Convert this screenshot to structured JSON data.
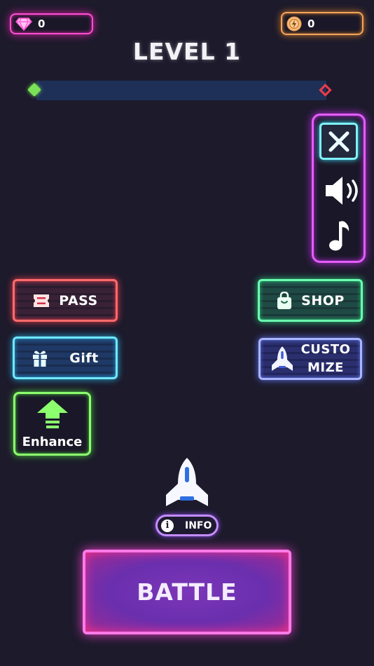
{
  "currency": {
    "gems": "0",
    "energy": "0"
  },
  "level": {
    "title": "LEVEL 1",
    "progress": 0
  },
  "settings": {
    "items": [
      "close-icon",
      "sound-icon",
      "music-note-icon"
    ]
  },
  "menu": {
    "pass_label": "PASS",
    "shop_label": "SHOP",
    "gift_label": "Gift",
    "customize_line1": "CUSTO",
    "customize_line2": "MIZE",
    "enhance_label": "Enhance"
  },
  "info_label": "INFO",
  "battle_label": "BATTLE",
  "colors": {
    "background": "#1c1a2b",
    "gem_accent": "#ff4fd2",
    "energy_accent": "#f2a55a",
    "settings_accent": "#e45dff",
    "pass_accent": "#ff6b6b",
    "shop_accent": "#6bffb0",
    "gift_accent": "#6fe7ff",
    "customize_accent": "#a8b6ff",
    "enhance_accent": "#8cff6e",
    "battle_accent": "#ff7ae8"
  }
}
